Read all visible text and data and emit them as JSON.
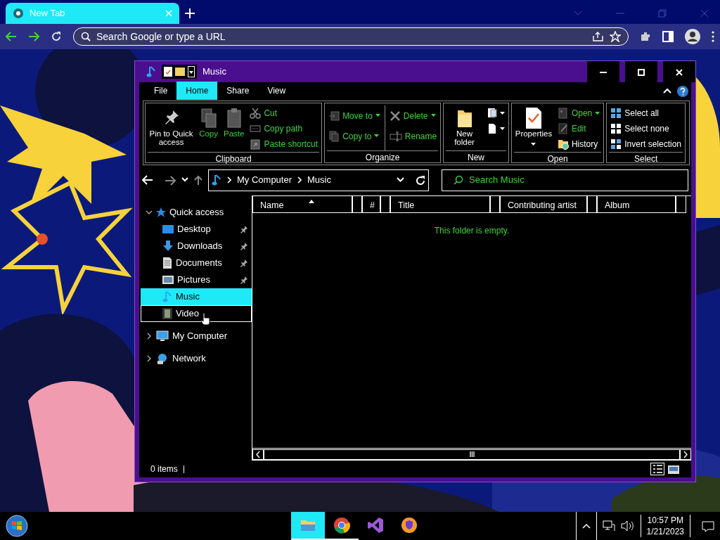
{
  "browser": {
    "tabs": [
      {
        "title": "New Tab",
        "selected": true
      }
    ],
    "omnibox": {
      "placeholder": "Search Google or type a URL"
    }
  },
  "explorer": {
    "title": "Music",
    "ribbon_tabs": [
      {
        "label": "File",
        "selected": false
      },
      {
        "label": "Home",
        "selected": true
      },
      {
        "label": "Share",
        "selected": false
      },
      {
        "label": "View",
        "selected": false
      }
    ],
    "ribbon_groups": [
      {
        "label": "Clipboard",
        "columns": [
          {
            "kind": "large",
            "items": [
              {
                "label": "Pin to Quick access",
                "disabled": false,
                "dropdown": false
              },
              {
                "label": "Copy",
                "disabled": true,
                "dropdown": false
              },
              {
                "label": "Paste",
                "disabled": true,
                "dropdown": false
              }
            ]
          },
          {
            "kind": "small",
            "items": [
              {
                "label": "Cut",
                "disabled": true,
                "dropdown": false
              },
              {
                "label": "Copy path",
                "disabled": true,
                "dropdown": false
              },
              {
                "label": "Paste shortcut",
                "disabled": true,
                "dropdown": false
              }
            ]
          }
        ]
      },
      {
        "label": "Organize",
        "columns": [
          {
            "kind": "small",
            "items": [
              {
                "label": "Move to",
                "disabled": true,
                "dropdown": true
              },
              {
                "label": "Copy to",
                "disabled": true,
                "dropdown": true
              }
            ]
          },
          {
            "kind": "small",
            "items": [
              {
                "label": "Delete",
                "disabled": true,
                "dropdown": true
              },
              {
                "label": "Rename",
                "disabled": true,
                "dropdown": false
              }
            ]
          }
        ]
      },
      {
        "label": "New",
        "columns": [
          {
            "kind": "large",
            "items": [
              {
                "label": "New folder",
                "disabled": false,
                "dropdown": false
              }
            ]
          },
          {
            "kind": "iconsmall",
            "items": [
              {
                "dropdown": true
              },
              {
                "dropdown": true
              }
            ]
          }
        ]
      },
      {
        "label": "Open",
        "columns": [
          {
            "kind": "large",
            "items": [
              {
                "label": "Properties",
                "disabled": false,
                "dropdown": true
              }
            ]
          },
          {
            "kind": "small",
            "items": [
              {
                "label": "Open",
                "disabled": true,
                "dropdown": true
              },
              {
                "label": "Edit",
                "disabled": true,
                "dropdown": false
              },
              {
                "label": "History",
                "disabled": false,
                "dropdown": false
              }
            ]
          }
        ]
      },
      {
        "label": "Select",
        "columns": [
          {
            "kind": "small",
            "items": [
              {
                "label": "Select all",
                "disabled": false,
                "dropdown": false
              },
              {
                "label": "Select none",
                "disabled": false,
                "dropdown": false
              },
              {
                "label": "Invert selection",
                "disabled": false,
                "dropdown": false
              }
            ]
          }
        ]
      }
    ],
    "address": {
      "path": [
        "My Computer",
        "Music"
      ]
    },
    "search": {
      "placeholder": "Search Music"
    },
    "nav_tree": [
      {
        "label": "Quick access",
        "expanded": true,
        "selected": false,
        "hovered": false,
        "children": [
          {
            "label": "Desktop",
            "pinned": true,
            "selected": false,
            "hovered": false
          },
          {
            "label": "Downloads",
            "pinned": true,
            "selected": false,
            "hovered": false
          },
          {
            "label": "Documents",
            "pinned": true,
            "selected": false,
            "hovered": false
          },
          {
            "label": "Pictures",
            "pinned": true,
            "selected": false,
            "hovered": false
          },
          {
            "label": "Music",
            "pinned": false,
            "selected": true,
            "hovered": false
          },
          {
            "label": "Video",
            "pinned": false,
            "selected": false,
            "hovered": true
          }
        ]
      },
      {
        "label": "My Computer",
        "expanded": false,
        "selected": false,
        "hovered": false
      },
      {
        "label": "Network",
        "expanded": false,
        "selected": false,
        "hovered": false
      }
    ],
    "columns": [
      {
        "label": "Name",
        "sorted": true
      },
      {
        "label": "#",
        "sorted": false
      },
      {
        "label": "Title",
        "sorted": false
      },
      {
        "label": "Contributing artist",
        "sorted": false
      },
      {
        "label": "Album",
        "sorted": false
      }
    ],
    "empty_message": "This folder is empty.",
    "status": "0 items"
  },
  "taskbar": {
    "apps": [
      {
        "selected": true,
        "running": true
      },
      {
        "selected": false,
        "running": true
      },
      {
        "selected": false,
        "running": false
      },
      {
        "selected": false,
        "running": false
      }
    ],
    "clock": {
      "time": "10:57 PM",
      "date": "1/21/2023"
    }
  }
}
